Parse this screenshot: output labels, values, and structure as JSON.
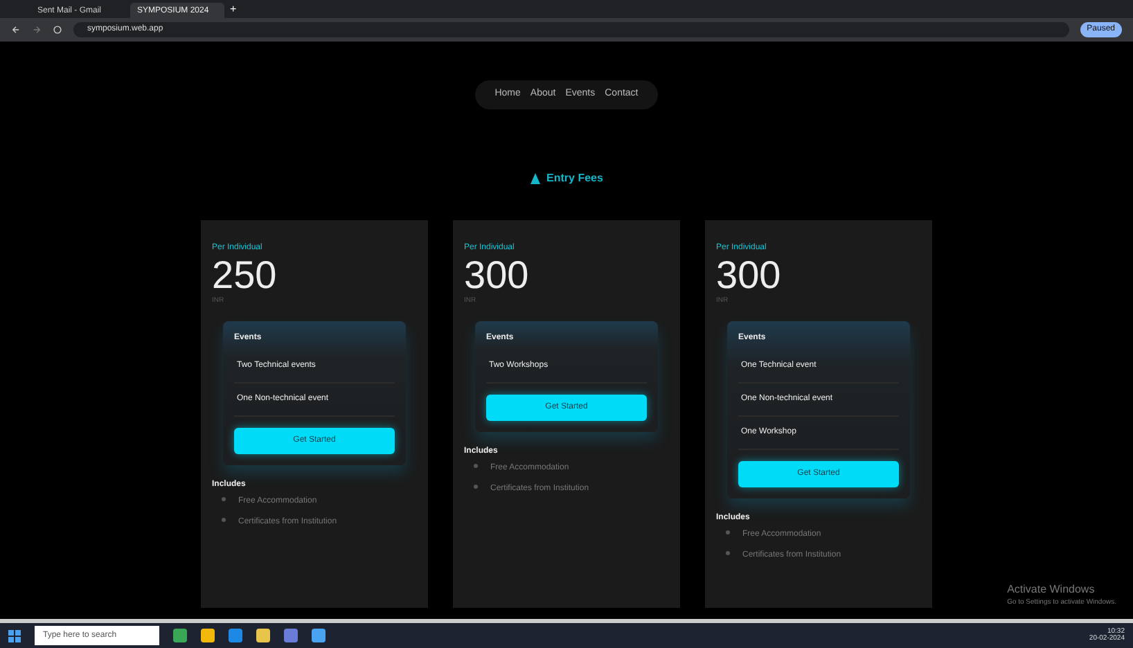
{
  "browser": {
    "tabs": [
      {
        "title": "Sent Mail - Gmail",
        "selected": false
      },
      {
        "title": "SYMPOSIUM 2024",
        "selected": true
      }
    ],
    "new_tab": "+",
    "address": "symposium.web.app",
    "profile": "Paused"
  },
  "nav": {
    "links": [
      "Home",
      "About",
      "Events",
      "Contact"
    ]
  },
  "heading": "Entry Fees",
  "plans": [
    {
      "audience": "Per Individual",
      "price": "250",
      "unit": "INR",
      "events_title": "Events",
      "events": [
        "Two Technical events",
        "One Non-technical event"
      ],
      "button": "Get Started",
      "includes_title": "Includes",
      "includes": [
        "Free Accommodation",
        "Certificates from Institution"
      ]
    },
    {
      "audience": "Per Individual",
      "price": "300",
      "unit": "INR",
      "events_title": "Events",
      "events": [
        "Two Workshops"
      ],
      "button": "Get Started",
      "includes_title": "Includes",
      "includes": [
        "Free Accommodation",
        "Certificates from Institution"
      ]
    },
    {
      "audience": "Per Individual",
      "price": "300",
      "unit": "INR",
      "events_title": "Events",
      "events": [
        "One Technical event",
        "One Non-technical event",
        "One Workshop"
      ],
      "button": "Get Started",
      "includes_title": "Includes",
      "includes": [
        "Free Accommodation",
        "Certificates from Institution"
      ]
    }
  ],
  "watermark_notice": {
    "title": "Activate Windows",
    "subtitle": "Go to Settings to activate Windows."
  },
  "taskbar": {
    "search_placeholder": "Type here to search",
    "time": "10:32",
    "date": "20-02-2024"
  }
}
